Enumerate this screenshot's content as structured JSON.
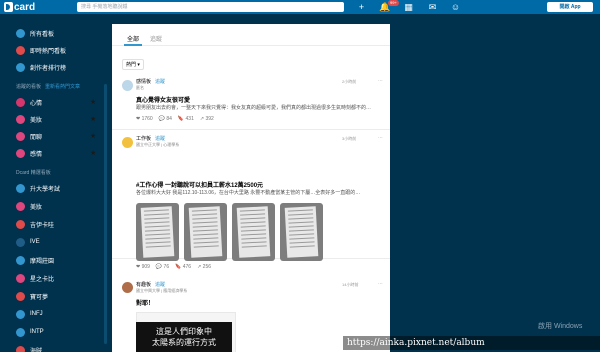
{
  "topbar": {
    "logo": "card",
    "search_placeholder": "搜尋 手機落地聽說鐵",
    "notif_badge": "99+",
    "app_button": "開啟 App"
  },
  "sidebar": {
    "main": [
      {
        "label": "所有看板",
        "icon": "grid-icon",
        "color": "#3397cf"
      },
      {
        "label": "即時熱門看板",
        "icon": "flame-icon",
        "color": "#e14a4a"
      },
      {
        "label": "創作者排行榜",
        "icon": "star-badge-icon",
        "color": "#3397cf"
      }
    ],
    "followed_header": "追蹤的看板",
    "followed_link": "重新看熱門文章",
    "followed": [
      {
        "label": "心情",
        "color": "#d6366b"
      },
      {
        "label": "美妝",
        "color": "#e0467e"
      },
      {
        "label": "閒聊",
        "color": "#e0467e"
      },
      {
        "label": "感情",
        "color": "#e0467e"
      }
    ],
    "boards_header": "Dcard 精選看板",
    "boards": [
      {
        "label": "升大學考試",
        "color": "#3397cf"
      },
      {
        "label": "美妝",
        "color": "#e0467e"
      },
      {
        "label": "吉伊卡哇",
        "color": "#e14a4a"
      },
      {
        "label": "IVE",
        "color": "#1f5d86"
      },
      {
        "label": "摩羯莊園",
        "color": "#3397cf"
      },
      {
        "label": "星之卡比",
        "color": "#e0467e"
      },
      {
        "label": "寶可夢",
        "color": "#e14a4a"
      },
      {
        "label": "INFJ",
        "color": "#3397cf"
      },
      {
        "label": "INTP",
        "color": "#3397cf"
      },
      {
        "label": "海賊",
        "color": "#e14a4a"
      }
    ]
  },
  "main": {
    "tabs": [
      {
        "label": "全部"
      },
      {
        "label": "追蹤"
      }
    ],
    "sort_label": "熱門 ▾",
    "posts": [
      {
        "board": "感情板",
        "follow": "追蹤",
        "author": "匿名",
        "time": "2小時前",
        "title": "真心覺得女友很可愛",
        "excerpt": "跟男朋友出去約會，一整天下來我只覺得：我女友真的超級可愛，我們真的都出現過很多生氣時刻都不的…",
        "stats": [
          "❤ 1760",
          "💬 84",
          "🔖 431",
          "↗ 392"
        ]
      },
      {
        "board": "工作板",
        "follow": "追蹤",
        "author": "國立中正大學 | 心理學系",
        "time": "3小時前",
        "title": "#工作心得 一封聽說可以扣員工薪水12萬2500元",
        "excerpt": "各位爆料大大好 我是112.10-113.06，在台中大里路 永豐不動產當某主管的下屬…全表好多一直跟的…",
        "stats": [
          "❤ 909",
          "💬 76",
          "🔖 476",
          "↗ 256"
        ]
      },
      {
        "board": "有趣板",
        "follow": "追蹤",
        "author": "國立中興大學 | 應用經濟學系",
        "time": "14小時前",
        "title": "對耶！",
        "excerpt": "",
        "stats": []
      }
    ],
    "overlay_lines": [
      "這是人們印象中",
      "太陽系的運行方式"
    ]
  },
  "watermark": "啟用 Windows",
  "url_bar": "https://ainka.pixnet.net/album"
}
